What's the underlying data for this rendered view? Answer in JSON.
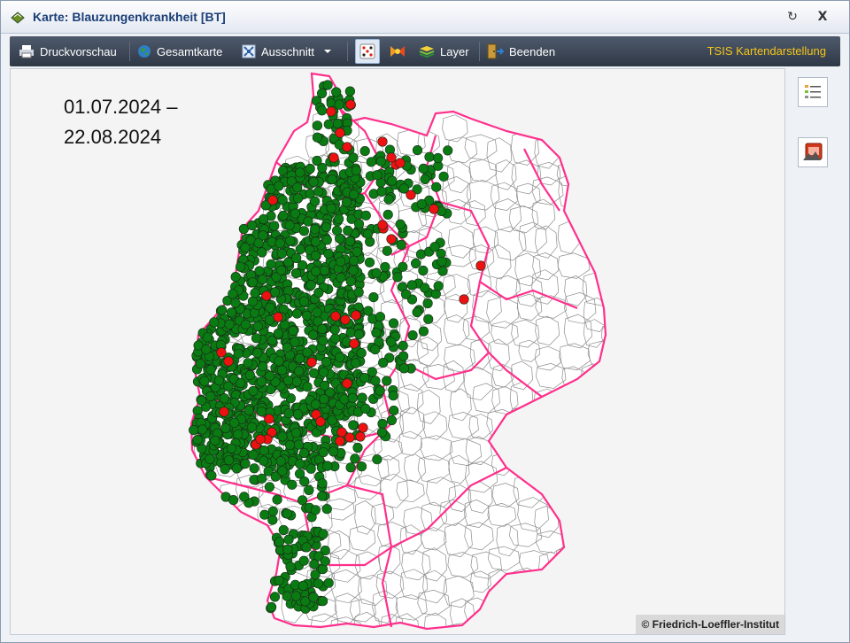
{
  "window": {
    "title": "Karte: Blauzungenkrankheit [BT]",
    "restore_glyph": "↻",
    "close_glyph": "X"
  },
  "toolbar": {
    "print_preview": "Druckvorschau",
    "full_map": "Gesamtkarte",
    "section": "Ausschnitt",
    "layer": "Layer",
    "exit": "Beenden",
    "brand": "TSIS Kartendarstellung"
  },
  "map": {
    "date_from": "01.07.2024 –",
    "date_to": "22.08.2024",
    "credit": "© Friedrich-Loeffler-Institut",
    "colors": {
      "state_border": "#ff2f8c",
      "district_border": "#8c8c8c",
      "outbreak_green": "#0a7a12",
      "outbreak_red": "#ee1111",
      "background": "#f4f4f4"
    }
  },
  "icons": {
    "title": "map-window-icon",
    "print": "printer-icon",
    "globe": "globe-icon",
    "section": "section-icon",
    "dots": "dice-icon",
    "marker": "marker-icon",
    "layer": "layers-icon",
    "exit": "exit-icon",
    "legend": "legend-icon",
    "map_export": "map-export-icon"
  }
}
